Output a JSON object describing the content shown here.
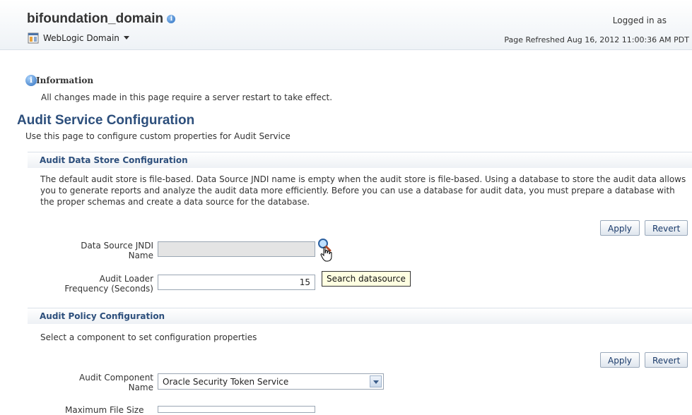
{
  "header": {
    "domain_name": "bifoundation_domain",
    "menu_label": "WebLogic Domain",
    "logged_in": "Logged in as",
    "page_refreshed": "Page Refreshed Aug 16, 2012 11:00:36 AM PDT"
  },
  "information": {
    "title": "Information",
    "message": "All changes made in this page require a server restart to take effect."
  },
  "page": {
    "title": "Audit Service Configuration",
    "description": "Use this page to configure custom properties for Audit Service"
  },
  "audit_data_store": {
    "section_title": "Audit Data Store Configuration",
    "description": "The default audit store is file-based. Data Source JNDI name is empty when the audit store is file-based. Using a database to store the audit data allows you to generate reports and analyze the audit data more efficiently. Before you can use a database for audit data, you must prepare a database with the proper schemas and create a data source for the database.",
    "apply_label": "Apply",
    "revert_label": "Revert",
    "jndi_label_line1": "Data Source JNDI",
    "jndi_label_line2": "Name",
    "jndi_value": "",
    "loader_label_line1": "Audit Loader",
    "loader_label_line2": "Frequency (Seconds)",
    "loader_value": "15",
    "tooltip": "Search datasource"
  },
  "audit_policy": {
    "section_title": "Audit Policy Configuration",
    "description": "Select a component to set configuration properties",
    "apply_label": "Apply",
    "revert_label": "Revert",
    "component_label_line1": "Audit Component",
    "component_label_line2": "Name",
    "component_value": "Oracle Security Token Service",
    "max_file_size_label": "Maximum File Size"
  },
  "colors": {
    "heading": "#2d4f7c",
    "info_icon": "#2e6fbe",
    "tooltip_bg": "#ffffe1"
  },
  "icons": [
    "info-icon",
    "domain-icon",
    "chevron-down-icon",
    "search-icon",
    "hand-cursor-icon"
  ]
}
